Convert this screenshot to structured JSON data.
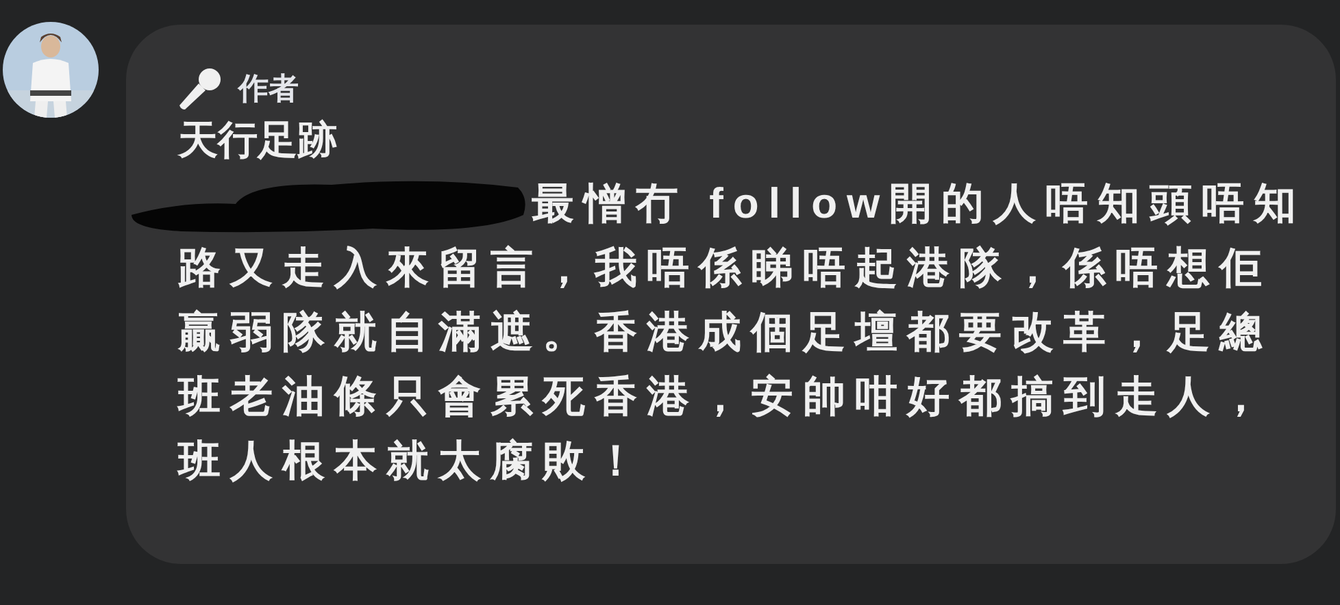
{
  "comment": {
    "badge": "作者",
    "author": "天行足跡",
    "redacted": true,
    "lines": [
      "最憎冇 follow開的人唔知頭唔知",
      "路又走入來留言，我唔係睇唔起港隊，係唔想佢",
      "贏弱隊就自滿遮。香港成個足壇都要改革，足總",
      "班老油條只會累死香港，安帥咁好都搞到走人，",
      "班人根本就太腐敗！"
    ]
  }
}
